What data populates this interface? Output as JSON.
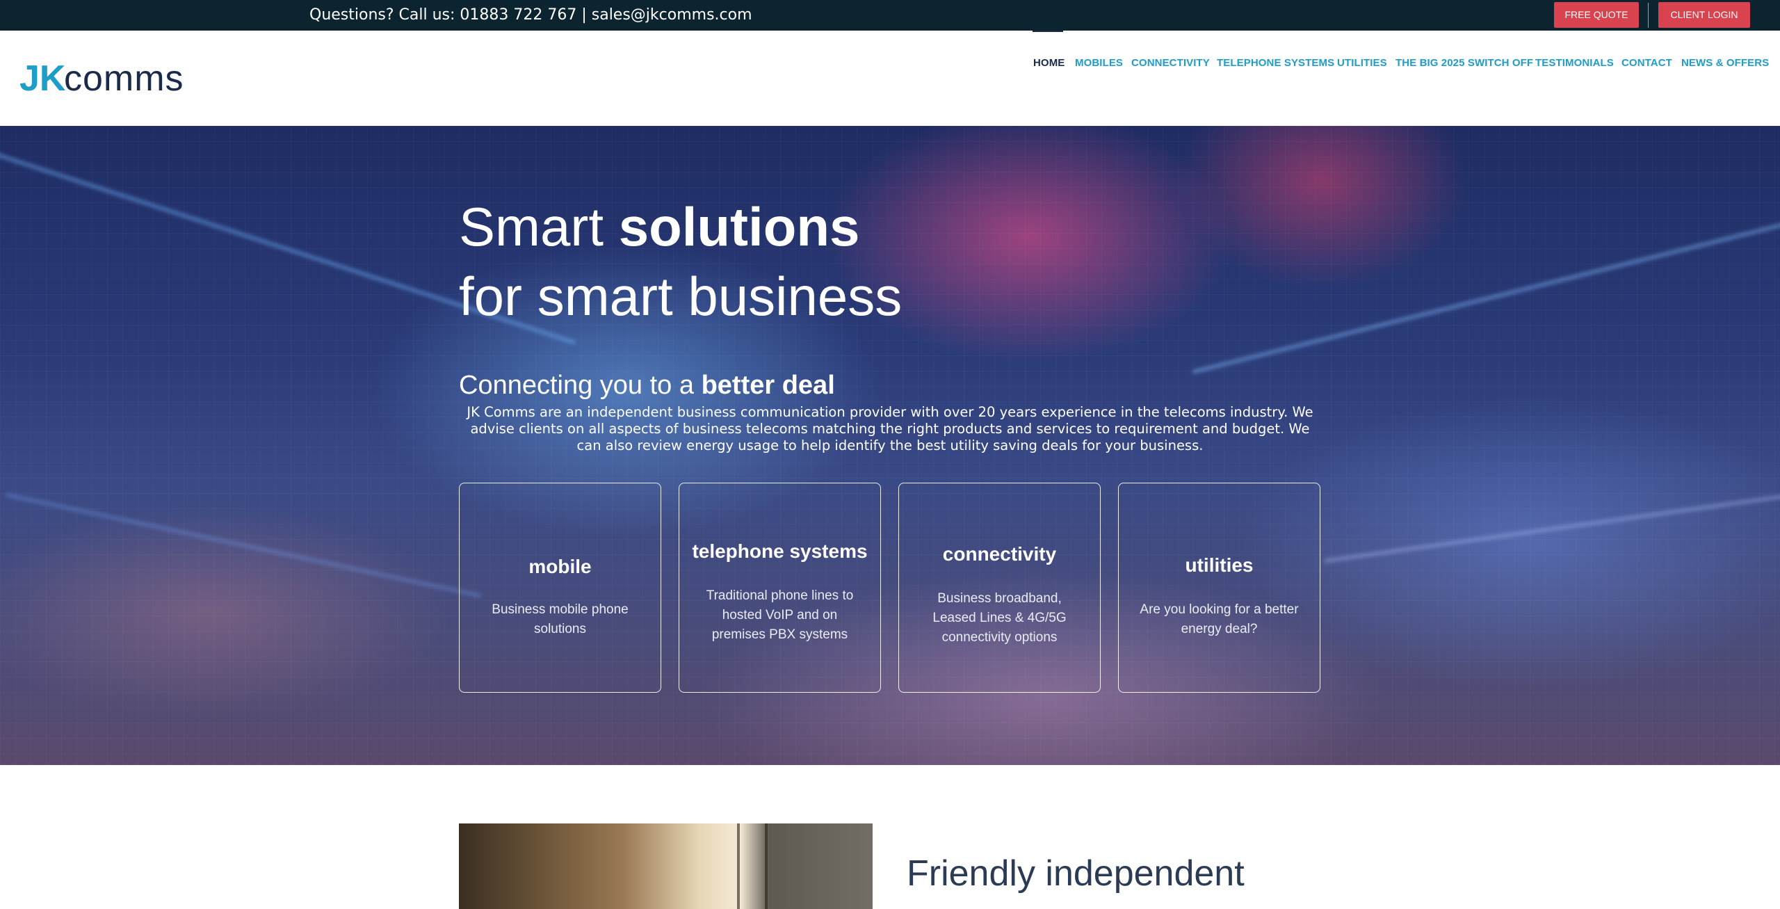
{
  "topbar": {
    "contact": "Questions? Call us: 01883 722 767 | sales@jkcomms.com",
    "free_quote": "FREE QUOTE",
    "client_login": "CLIENT LOGIN"
  },
  "brand": {
    "logo_text": "JKcomms",
    "primary": "#1e9dc8",
    "dark": "#1b2a4a",
    "accent": "#d9434f"
  },
  "nav": [
    {
      "label": "HOME",
      "active": true
    },
    {
      "label": "MOBILES"
    },
    {
      "label": "CONNECTIVITY"
    },
    {
      "label": "TELEPHONE SYSTEMS"
    },
    {
      "label": "UTILITIES"
    },
    {
      "label": "THE BIG 2025 SWITCH OFF"
    },
    {
      "label": "TESTIMONIALS"
    },
    {
      "label": "CONTACT"
    },
    {
      "label": "NEWS & OFFERS"
    }
  ],
  "hero": {
    "line1_light": "Smart ",
    "line1_bold": "solutions",
    "line2": "for smart business",
    "sub_light": "Connecting you to a ",
    "sub_bold": "better deal",
    "intro": "JK Comms are an independent business communication provider with over 20 years experience in the telecoms industry. We advise clients on all aspects of business telecoms matching the right products and services to requirement and budget. We can also review energy usage to help identify the best utility saving deals for your business.",
    "cards": [
      {
        "title": "mobile",
        "desc": "Business mobile phone solutions"
      },
      {
        "title": "telephone systems",
        "desc": "Traditional phone lines to hosted VoIP and on premises PBX systems"
      },
      {
        "title": "connectivity",
        "desc": "Business broadband, Leased Lines & 4G/5G connectivity options"
      },
      {
        "title": "utilities",
        "desc": "Are you looking for a better energy deal?"
      }
    ]
  },
  "section2": {
    "heading": "Friendly independent"
  }
}
